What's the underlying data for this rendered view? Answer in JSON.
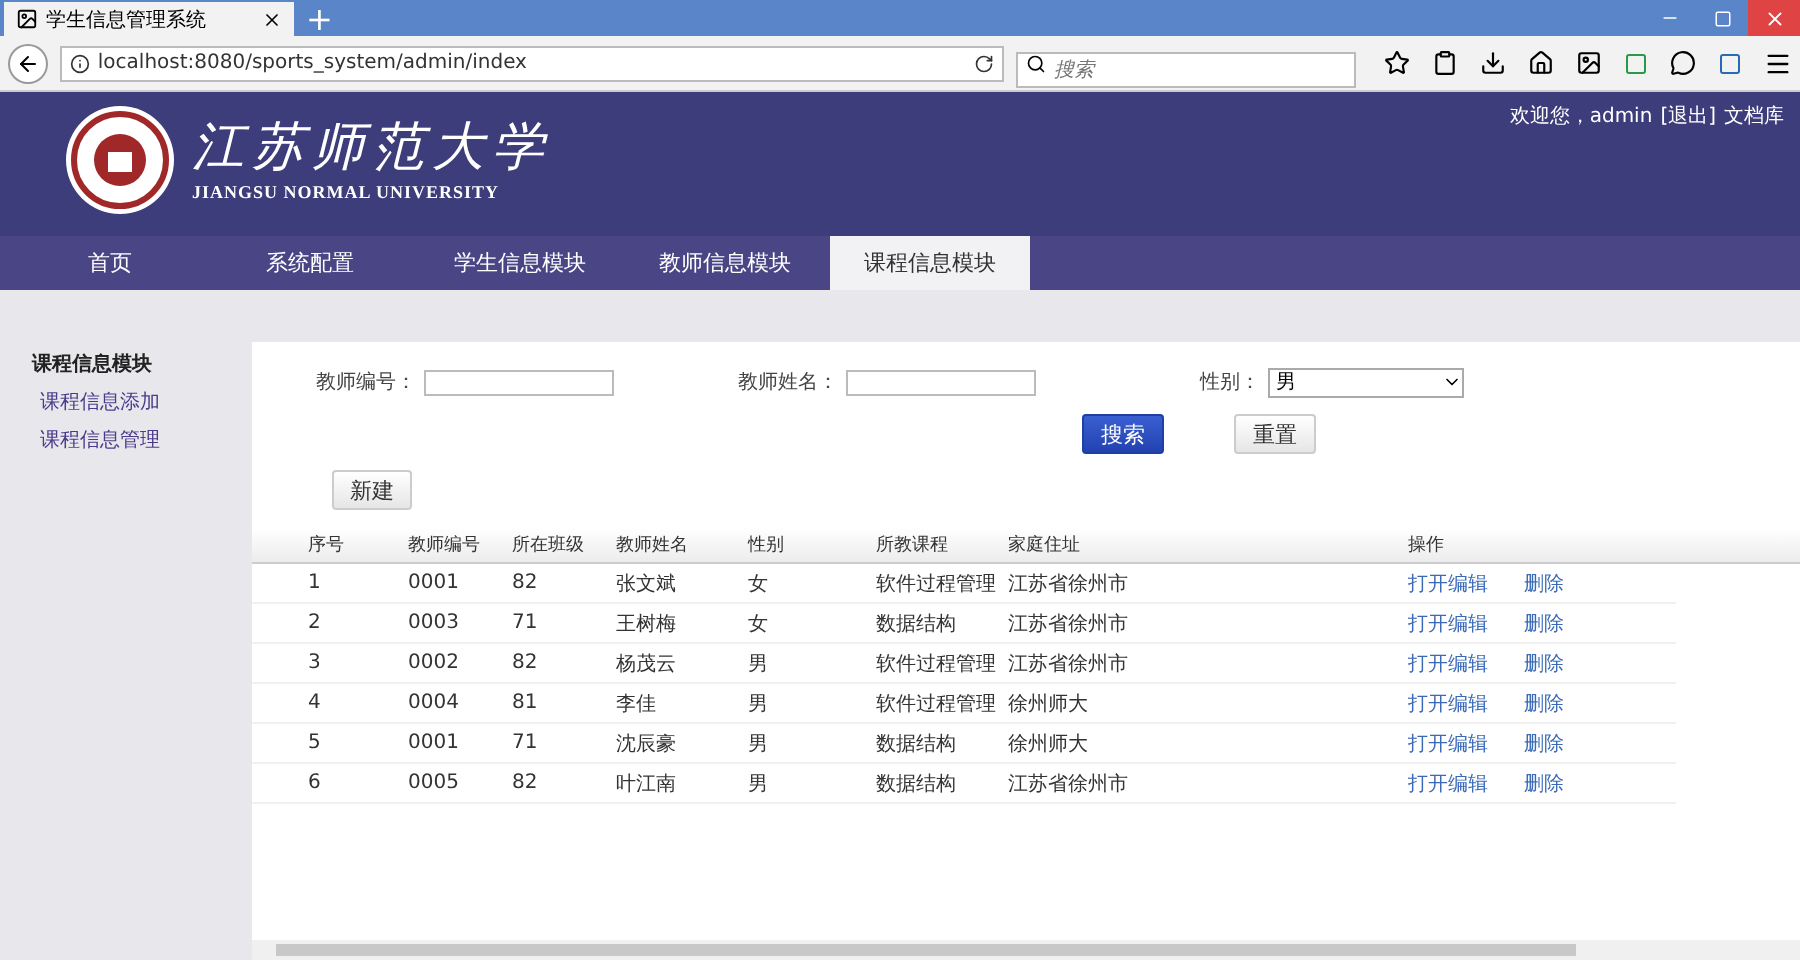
{
  "browser": {
    "tab_title": "学生信息管理系统",
    "new_tab": "+",
    "url": "localhost:8080/sports_system/admin/index",
    "search_placeholder": "搜索"
  },
  "header": {
    "logo_title": "江苏师范大学",
    "logo_subtitle": "JIANGSU NORMAL UNIVERSITY",
    "user_links": [
      {
        "label": "欢迎您，admin"
      },
      {
        "label": "[退出]"
      },
      {
        "label": "文档库"
      }
    ]
  },
  "nav": [
    {
      "label": "首页",
      "selected": false
    },
    {
      "label": "系统配置",
      "selected": false
    },
    {
      "label": "学生信息模块",
      "selected": false
    },
    {
      "label": "教师信息模块",
      "selected": false
    },
    {
      "label": "课程信息模块",
      "selected": true
    }
  ],
  "sidebar": {
    "title": "课程信息模块",
    "items": [
      {
        "label": "课程信息添加"
      },
      {
        "label": "课程信息管理"
      }
    ]
  },
  "filters": {
    "teacher_id_label": "教师编号：",
    "teacher_name_label": "教师姓名：",
    "gender_label": "性别：",
    "gender_value": "男",
    "search_button": "搜索",
    "reset_button": "重置"
  },
  "new_button": "新建",
  "table": {
    "columns": [
      "序号",
      "教师编号",
      "所在班级",
      "教师姓名",
      "性别",
      "所教课程",
      "家庭住址",
      "操作"
    ],
    "rows": [
      {
        "cells": [
          "1",
          "0001",
          "82",
          "张文斌",
          "女",
          "软件过程管理",
          "江苏省徐州市"
        ],
        "actions": [
          "打开编辑",
          "删除"
        ]
      },
      {
        "cells": [
          "2",
          "0003",
          "71",
          "王树梅",
          "女",
          "数据结构",
          "江苏省徐州市"
        ],
        "actions": [
          "打开编辑",
          "删除"
        ]
      },
      {
        "cells": [
          "3",
          "0002",
          "82",
          "杨茂云",
          "男",
          "软件过程管理",
          "江苏省徐州市"
        ],
        "actions": [
          "打开编辑",
          "删除"
        ]
      },
      {
        "cells": [
          "4",
          "0004",
          "81",
          "李佳",
          "男",
          "软件过程管理",
          "徐州师大"
        ],
        "actions": [
          "打开编辑",
          "删除"
        ]
      },
      {
        "cells": [
          "5",
          "0001",
          "71",
          "沈辰豪",
          "男",
          "数据结构",
          "徐州师大"
        ],
        "actions": [
          "打开编辑",
          "删除"
        ]
      },
      {
        "cells": [
          "6",
          "0005",
          "82",
          "叶江南",
          "男",
          "数据结构",
          "江苏省徐州市"
        ],
        "actions": [
          "打开编辑",
          "删除"
        ]
      }
    ]
  }
}
